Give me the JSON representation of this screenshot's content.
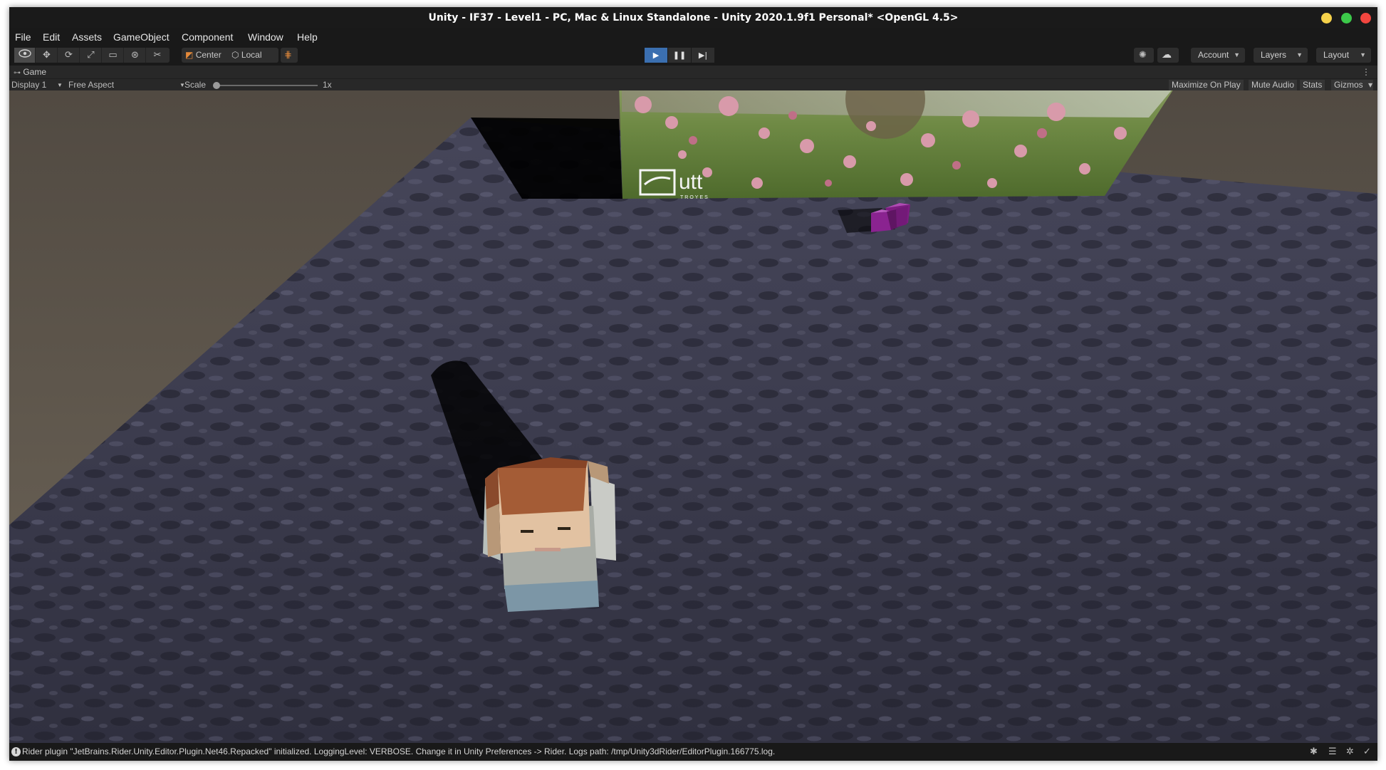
{
  "window": {
    "title": "Unity - IF37 - Level1 - PC, Mac & Linux Standalone - Unity 2020.1.9f1 Personal* <OpenGL 4.5>",
    "controls": {
      "minimize_color": "#f5d14a",
      "maximize_color": "#3cc94a",
      "close_color": "#f2463f"
    }
  },
  "menu": [
    "File",
    "Edit",
    "Assets",
    "GameObject",
    "Component",
    "Window",
    "Help"
  ],
  "toolbar": {
    "tools": [
      "view-tool",
      "move-tool",
      "rotate-tool",
      "scale-tool",
      "rect-tool",
      "transform-tool",
      "custom-tool"
    ],
    "pivot_center": "Center",
    "pivot_local": "Local",
    "play_active": true,
    "account": "Account",
    "layers": "Layers",
    "layout": "Layout",
    "accent": "#3b6fb0"
  },
  "game_view": {
    "tab_label": "Game",
    "display": "Display 1",
    "aspect": "Free Aspect",
    "scale_label": "Scale",
    "scale_value": "1x",
    "buttons": [
      "Maximize On Play",
      "Mute Audio",
      "Stats",
      "Gizmos"
    ]
  },
  "scene": {
    "billboard_logo": "utt",
    "billboard_subtext": "TROYES"
  },
  "status": {
    "message": "Rider plugin \"JetBrains.Rider.Unity.Editor.Plugin.Net46.Repacked\" initialized. LoggingLevel: VERBOSE. Change it in Unity Preferences -> Rider. Logs path: /tmp/Unity3dRider/EditorPlugin.166775.log."
  }
}
